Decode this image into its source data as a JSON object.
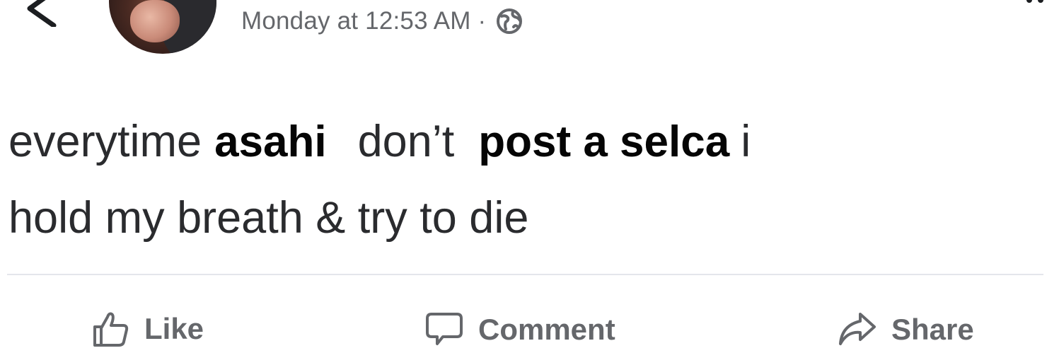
{
  "post": {
    "timestamp": "Monday at 12:53 AM",
    "separator": "·",
    "privacy_icon": "globe-icon",
    "text": {
      "line1": {
        "part1": "everytime",
        "highlight1": "asahi",
        "part2": "don’t",
        "highlight2": "post a selca",
        "part3": "i"
      },
      "line2": "hold my breath & try to die"
    }
  },
  "actions": {
    "like_label": "Like",
    "comment_label": "Comment",
    "share_label": "Share"
  },
  "icons": {
    "back": "chevron-left-icon",
    "more": "more-dots-icon",
    "like": "thumbs-up-icon",
    "comment": "comment-bubble-icon",
    "share": "share-arrow-icon"
  },
  "colors": {
    "meta_text": "#65676b",
    "post_text": "#2a2b2e",
    "divider": "#e4e6eb"
  }
}
